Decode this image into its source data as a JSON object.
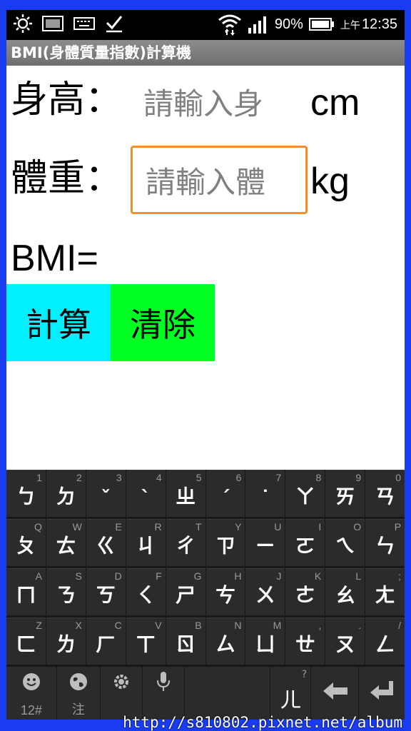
{
  "status_bar": {
    "icons_left": [
      "brightness-icon",
      "screenshot-icon",
      "keyboard-icon",
      "check-icon"
    ],
    "battery_percent": "90%",
    "time_prefix": "上午",
    "time": "12:35"
  },
  "app": {
    "title": "BMI(身體質量指數)計算機"
  },
  "form": {
    "height_label": "身高：",
    "height_placeholder": "請輸入身",
    "height_unit": "cm",
    "weight_label": "體重：",
    "weight_placeholder": "請輸入體",
    "weight_unit": "kg",
    "bmi_label": "BMI="
  },
  "buttons": {
    "calculate": "計算",
    "clear": "清除"
  },
  "colors": {
    "calculate_bg": "#00f0ff",
    "clear_bg": "#00ff22",
    "focus_border": "#f0902a"
  },
  "keyboard": {
    "rows": [
      [
        {
          "hint": "1",
          "key": "ㄅ"
        },
        {
          "hint": "2",
          "key": "ㄉ"
        },
        {
          "hint": "3",
          "key": "ˇ"
        },
        {
          "hint": "4",
          "key": "ˋ"
        },
        {
          "hint": "5",
          "key": "ㄓ"
        },
        {
          "hint": "6",
          "key": "ˊ"
        },
        {
          "hint": "7",
          "key": "˙"
        },
        {
          "hint": "8",
          "key": "ㄚ"
        },
        {
          "hint": "9",
          "key": "ㄞ"
        },
        {
          "hint": "0",
          "key": "ㄢ"
        }
      ],
      [
        {
          "hint": "Q",
          "key": "ㄆ"
        },
        {
          "hint": "W",
          "key": "ㄊ"
        },
        {
          "hint": "E",
          "key": "ㄍ"
        },
        {
          "hint": "R",
          "key": "ㄐ"
        },
        {
          "hint": "T",
          "key": "ㄔ"
        },
        {
          "hint": "Y",
          "key": "ㄗ"
        },
        {
          "hint": "U",
          "key": "ㄧ"
        },
        {
          "hint": "I",
          "key": "ㄛ"
        },
        {
          "hint": "O",
          "key": "ㄟ"
        },
        {
          "hint": "P",
          "key": "ㄣ"
        }
      ],
      [
        {
          "hint": "A",
          "key": "ㄇ"
        },
        {
          "hint": "S",
          "key": "ㄋ"
        },
        {
          "hint": "D",
          "key": "ㄎ"
        },
        {
          "hint": "F",
          "key": "ㄑ"
        },
        {
          "hint": "G",
          "key": "ㄕ"
        },
        {
          "hint": "H",
          "key": "ㄘ"
        },
        {
          "hint": "J",
          "key": "ㄨ"
        },
        {
          "hint": "K",
          "key": "ㄜ"
        },
        {
          "hint": "L",
          "key": "ㄠ"
        },
        {
          "hint": ";",
          "key": "ㄤ"
        }
      ],
      [
        {
          "hint": "Z",
          "key": "ㄈ"
        },
        {
          "hint": "X",
          "key": "ㄌ"
        },
        {
          "hint": "C",
          "key": "ㄏ"
        },
        {
          "hint": "V",
          "key": "ㄒ"
        },
        {
          "hint": "B",
          "key": "ㄖ"
        },
        {
          "hint": "N",
          "key": "ㄙ"
        },
        {
          "hint": "M",
          "key": "ㄩ"
        },
        {
          "hint": ",",
          "key": "ㄝ"
        },
        {
          "hint": ".",
          "key": "ㄡ"
        },
        {
          "hint": "/",
          "key": "ㄥ"
        }
      ]
    ],
    "bottom": {
      "emoji_sub": "12#",
      "globe_sub": "注",
      "er_hint": "?",
      "er_key": "ㄦ"
    }
  },
  "watermark": "http://s810802.pixnet.net/album"
}
